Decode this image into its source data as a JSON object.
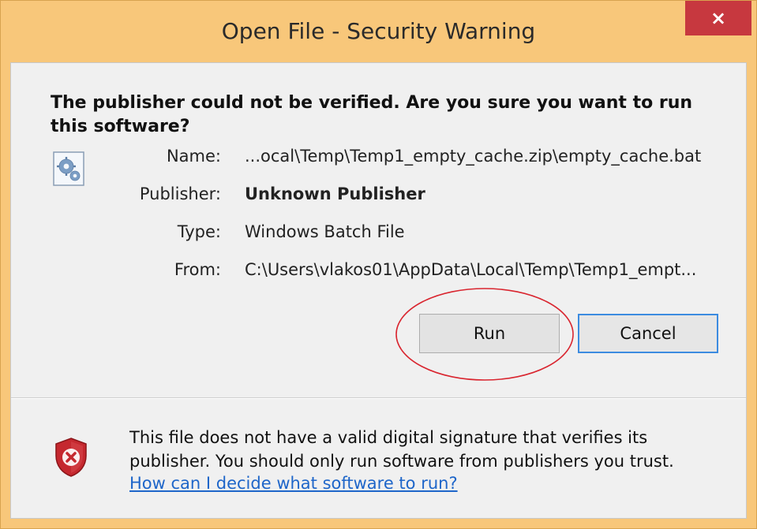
{
  "window": {
    "title": "Open File - Security Warning",
    "close_glyph": "×"
  },
  "question": "The publisher could not be verified.  Are you sure you want to run this software?",
  "file_icon": "gears-file-icon",
  "fields": {
    "name_label": "Name:",
    "name_value": "...ocal\\Temp\\Temp1_empty_cache.zip\\empty_cache.bat",
    "publisher_label": "Publisher:",
    "publisher_value": "Unknown Publisher",
    "type_label": "Type:",
    "type_value": "Windows Batch File",
    "from_label": "From:",
    "from_value": "C:\\Users\\vlakos01\\AppData\\Local\\Temp\\Temp1_empt..."
  },
  "buttons": {
    "run": "Run",
    "cancel": "Cancel"
  },
  "footer": {
    "shield_icon": "shield-error-icon",
    "warning_text": "This file does not have a valid digital signature that verifies its publisher.  You should only run software from publishers you trust.",
    "help_link": "How can I decide what software to run?"
  },
  "colors": {
    "titlebar": "#f8c77a",
    "close_button": "#c7383f",
    "link": "#1e66c9",
    "annotation": "#d9252f"
  }
}
